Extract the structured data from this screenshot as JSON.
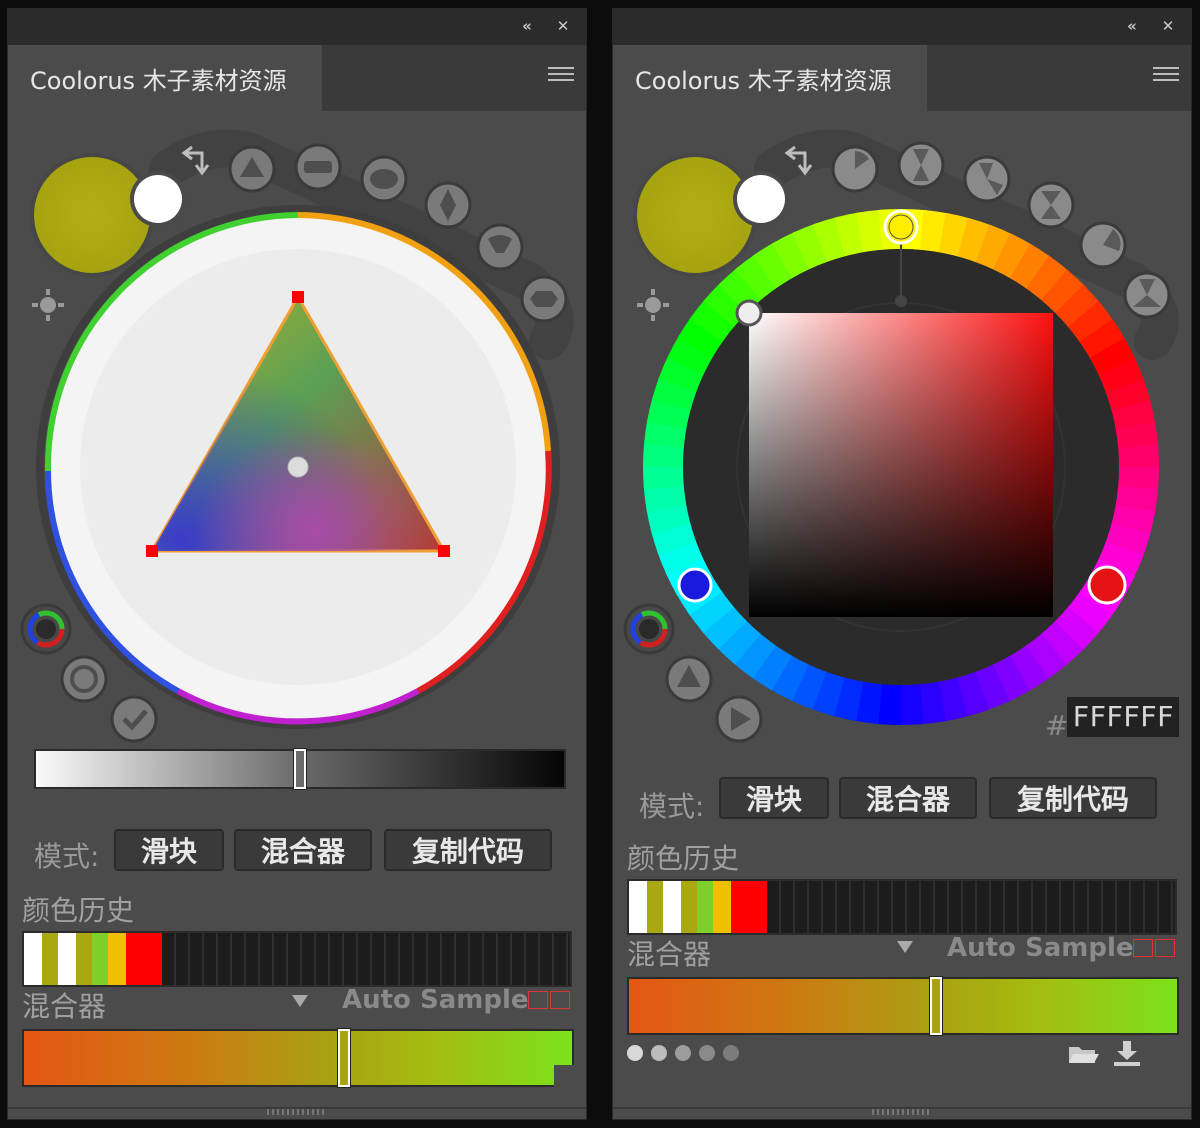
{
  "left_panel": {
    "title": "Coolorus 木子素材资源",
    "mode_label": "模式:",
    "buttons": {
      "slider": "滑块",
      "mixer": "混合器",
      "copy_code": "复制代码"
    },
    "history_label": "颜色历史",
    "history_colors": [
      "#ffffff",
      "#a9a712",
      "#ffffff",
      "#a9a712",
      "#7fcf2a",
      "#f0c000",
      "#ff0000"
    ],
    "mixer_label": "混合器",
    "auto_sample": "Auto Sample",
    "primary_color": "#aaa812",
    "secondary_color": "#ffffff",
    "brightness_slider": 0.5
  },
  "right_panel": {
    "title": "Coolorus 木子素材资源",
    "hash": "#",
    "hex_value": "FFFFFF",
    "mode_label": "模式:",
    "buttons": {
      "slider": "滑块",
      "mixer": "混合器",
      "copy_code": "复制代码"
    },
    "history_label": "颜色历史",
    "history_colors": [
      "#ffffff",
      "#a9a712",
      "#ffffff",
      "#a9a712",
      "#7fcf2a",
      "#f0c000",
      "#ff0000"
    ],
    "mixer_label": "混合器",
    "auto_sample": "Auto Sample",
    "primary_color": "#aaa812",
    "secondary_color": "#ffffff",
    "mixer_position": 0.56
  }
}
